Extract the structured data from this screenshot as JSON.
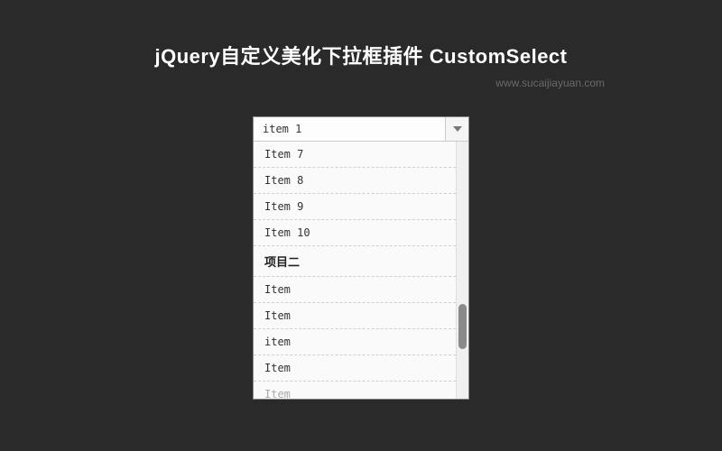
{
  "header": {
    "title": "jQuery自定义美化下拉框插件 CustomSelect",
    "subtitle": "www.sucaijiayuan.com"
  },
  "select": {
    "selected_value": "item 1",
    "arrow_icon": "chevron-down",
    "options": [
      {
        "label": "Item 7",
        "type": "item"
      },
      {
        "label": "Item 8",
        "type": "item"
      },
      {
        "label": "Item 9",
        "type": "item"
      },
      {
        "label": "Item 10",
        "type": "item"
      },
      {
        "label": "项目二",
        "type": "group"
      },
      {
        "label": "Item",
        "type": "item"
      },
      {
        "label": "Item",
        "type": "item"
      },
      {
        "label": "item",
        "type": "item"
      },
      {
        "label": "Item",
        "type": "item"
      },
      {
        "label": "Item",
        "type": "faded"
      }
    ]
  }
}
